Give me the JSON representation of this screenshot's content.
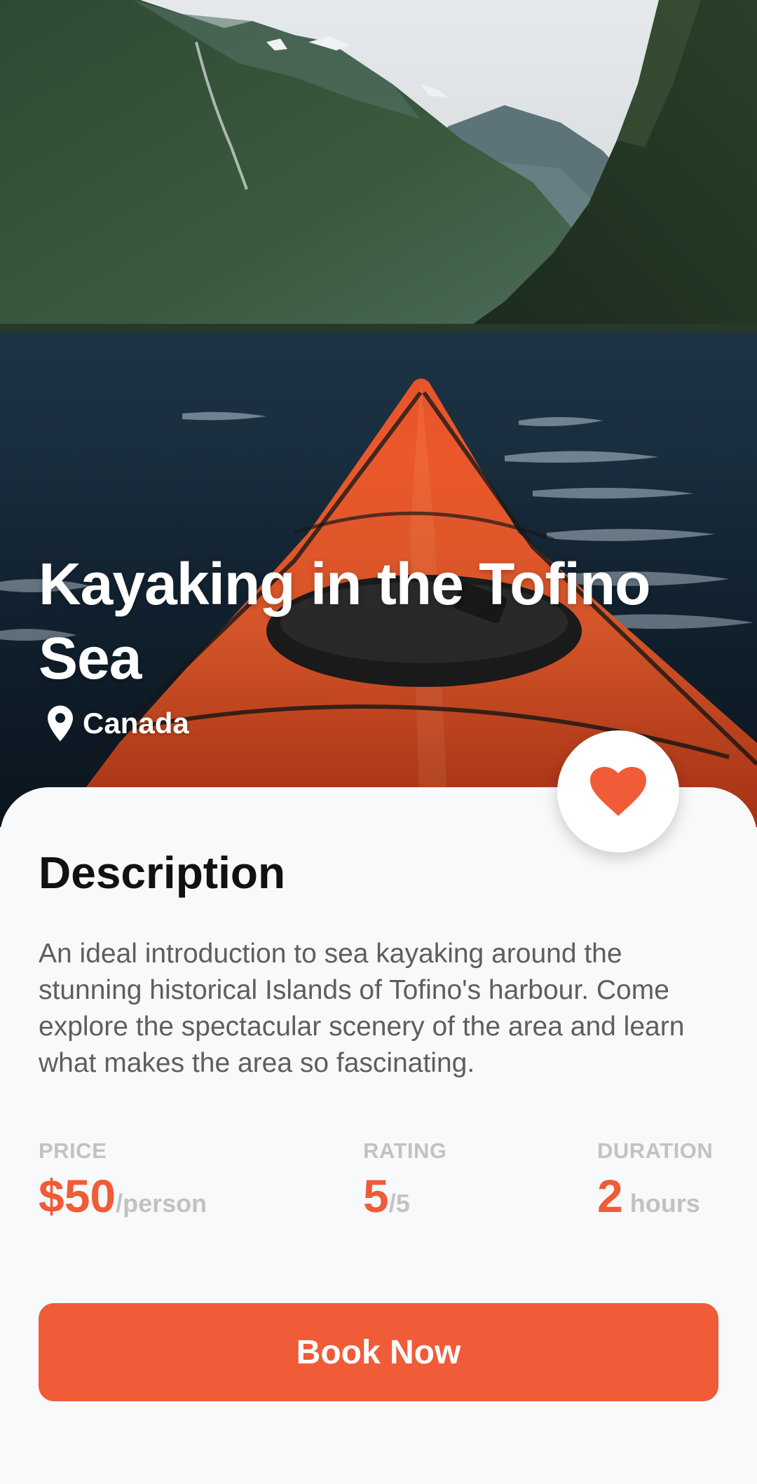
{
  "hero": {
    "title": "Kayaking in the Tofino Sea",
    "location": "Canada",
    "location_icon": "map-pin-icon"
  },
  "favorite": {
    "icon": "heart-icon",
    "active": true
  },
  "description": {
    "heading": "Description",
    "body": "An ideal introduction to sea kayaking around the stunning historical Islands of Tofino's harbour. Come explore the spectacular scenery of the area and learn what makes the area so fascinating."
  },
  "stats": {
    "price": {
      "label": "PRICE",
      "value": "$50",
      "unit": "/person"
    },
    "rating": {
      "label": "RATING",
      "value": "5",
      "unit": "/5"
    },
    "duration": {
      "label": "DURATION",
      "value": "2",
      "unit": " hours"
    }
  },
  "cta": {
    "label": "Book Now"
  },
  "colors": {
    "accent": "#f05b38",
    "background": "#f8f9fb",
    "text_primary": "#111111",
    "text_secondary": "#5e5e5e",
    "text_muted": "#c2c2c2"
  }
}
